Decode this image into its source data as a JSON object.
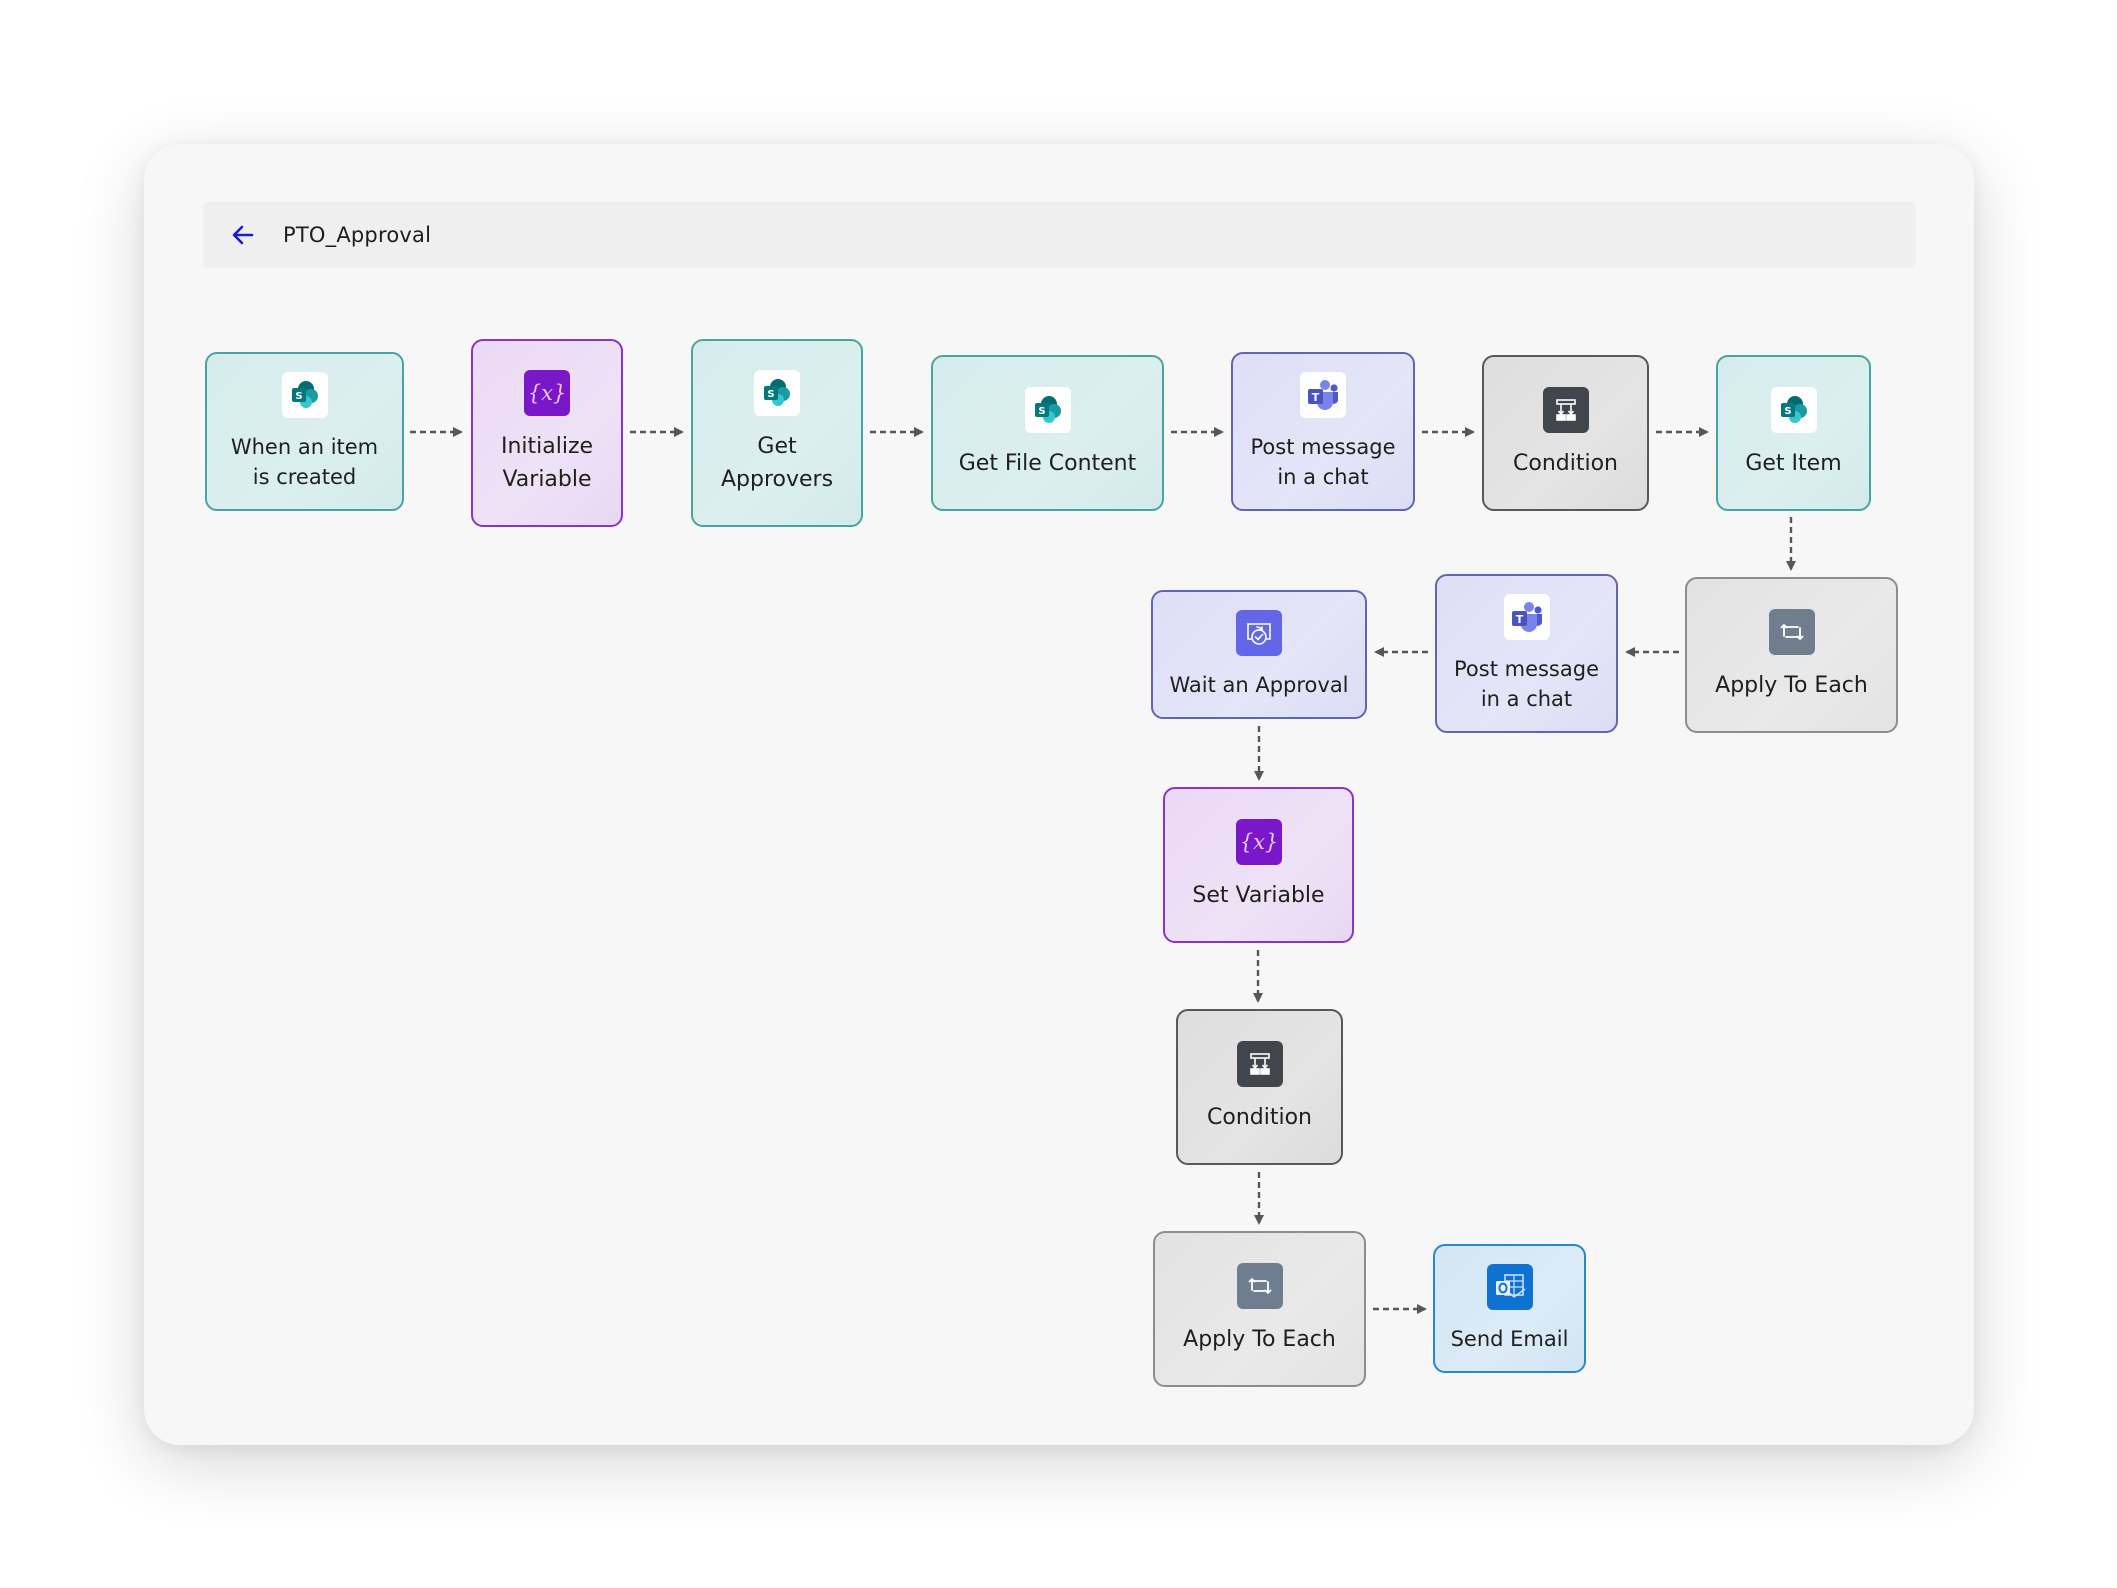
{
  "header": {
    "back_icon": "arrow-left-icon",
    "title": "PTO_Approval"
  },
  "colors": {
    "sharepoint_node": "#d8eded",
    "variable_node": "#ebdcf4",
    "teams_node": "#e0e1f7",
    "condition_node": "#e0e0e0",
    "loop_node": "#e6e6e6",
    "outlook_node": "#d7e8f5",
    "back_arrow": "#1a1ad6"
  },
  "flow": {
    "nodes": [
      {
        "id": "n1",
        "label": "When an item\nis created",
        "type": "sharepoint",
        "icon": "sharepoint-icon"
      },
      {
        "id": "n2",
        "label": "Initialize\nVariable",
        "type": "variable",
        "icon": "variable-icon"
      },
      {
        "id": "n3",
        "label": "Get\nApprovers",
        "type": "sharepoint",
        "icon": "sharepoint-icon"
      },
      {
        "id": "n4",
        "label": "Get File Content",
        "type": "sharepoint",
        "icon": "sharepoint-icon"
      },
      {
        "id": "n5",
        "label": "Post message\nin a chat",
        "type": "teams",
        "icon": "teams-icon"
      },
      {
        "id": "n6",
        "label": "Condition",
        "type": "condition",
        "icon": "condition-icon"
      },
      {
        "id": "n7",
        "label": "Get Item",
        "type": "sharepoint",
        "icon": "sharepoint-icon"
      },
      {
        "id": "n8",
        "label": "Apply To Each",
        "type": "loop",
        "icon": "loop-icon"
      },
      {
        "id": "n9",
        "label": "Post message\nin a chat",
        "type": "teams",
        "icon": "teams-icon"
      },
      {
        "id": "n10",
        "label": "Wait an Approval",
        "type": "approval",
        "icon": "approval-icon"
      },
      {
        "id": "n11",
        "label": "Set Variable",
        "type": "variable",
        "icon": "variable-icon"
      },
      {
        "id": "n12",
        "label": "Condition",
        "type": "condition",
        "icon": "condition-icon"
      },
      {
        "id": "n13",
        "label": "Apply To Each",
        "type": "loop",
        "icon": "loop-icon"
      },
      {
        "id": "n14",
        "label": "Send Email",
        "type": "outlook",
        "icon": "outlook-icon"
      }
    ],
    "edges": [
      [
        "n1",
        "n2"
      ],
      [
        "n2",
        "n3"
      ],
      [
        "n3",
        "n4"
      ],
      [
        "n4",
        "n5"
      ],
      [
        "n5",
        "n6"
      ],
      [
        "n6",
        "n7"
      ],
      [
        "n7",
        "n8"
      ],
      [
        "n8",
        "n9"
      ],
      [
        "n9",
        "n10"
      ],
      [
        "n10",
        "n11"
      ],
      [
        "n11",
        "n12"
      ],
      [
        "n12",
        "n13"
      ],
      [
        "n13",
        "n14"
      ]
    ]
  }
}
